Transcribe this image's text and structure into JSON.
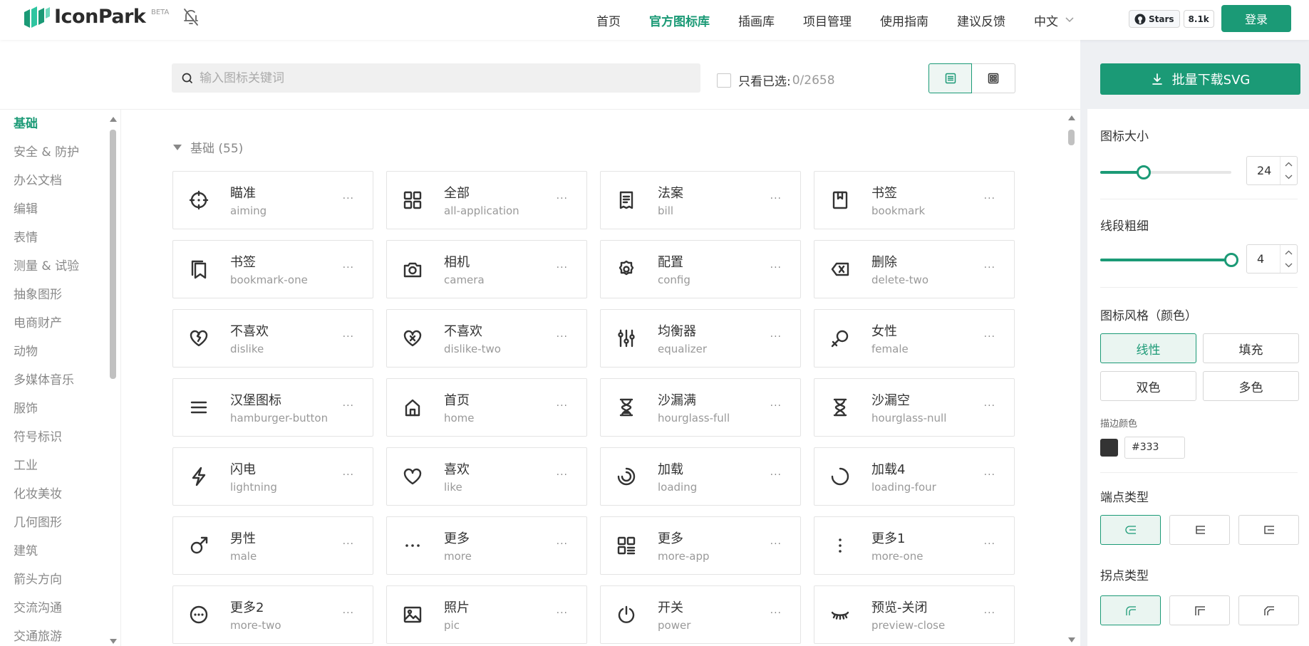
{
  "header": {
    "logo_text": "IconPark",
    "beta_label": "BETA",
    "nav": [
      {
        "label": "首页"
      },
      {
        "label": "官方图标库",
        "active": true
      },
      {
        "label": "插画库"
      },
      {
        "label": "项目管理"
      },
      {
        "label": "使用指南"
      },
      {
        "label": "建议反馈"
      }
    ],
    "language": "中文",
    "github": {
      "stars_label": "Stars",
      "count": "8.1k"
    },
    "login_label": "登录",
    "accent_color": "#1b9a76"
  },
  "toolbar": {
    "search_placeholder": "输入图标关键词",
    "only_selected_label": "只看已选:",
    "selected_count": "0/2658"
  },
  "sidebar": {
    "categories": [
      {
        "label": "基础",
        "active": true
      },
      {
        "label": "安全 & 防护"
      },
      {
        "label": "办公文档"
      },
      {
        "label": "编辑"
      },
      {
        "label": "表情"
      },
      {
        "label": "测量 & 试验"
      },
      {
        "label": "抽象图形"
      },
      {
        "label": "电商财产"
      },
      {
        "label": "动物"
      },
      {
        "label": "多媒体音乐"
      },
      {
        "label": "服饰"
      },
      {
        "label": "符号标识"
      },
      {
        "label": "工业"
      },
      {
        "label": "化妆美妆"
      },
      {
        "label": "几何图形"
      },
      {
        "label": "建筑"
      },
      {
        "label": "箭头方向"
      },
      {
        "label": "交流沟通"
      },
      {
        "label": "交通旅游"
      }
    ]
  },
  "main": {
    "section_title": "基础 (55)",
    "more_label": "···",
    "icons": [
      {
        "cn": "瞄准",
        "en": "aiming",
        "icon": "aiming-icon"
      },
      {
        "cn": "全部",
        "en": "all-application",
        "icon": "all-application-icon"
      },
      {
        "cn": "法案",
        "en": "bill",
        "icon": "bill-icon"
      },
      {
        "cn": "书签",
        "en": "bookmark",
        "icon": "bookmark-icon"
      },
      {
        "cn": "书签",
        "en": "bookmark-one",
        "icon": "bookmark-one-icon"
      },
      {
        "cn": "相机",
        "en": "camera",
        "icon": "camera-icon"
      },
      {
        "cn": "配置",
        "en": "config",
        "icon": "config-icon"
      },
      {
        "cn": "删除",
        "en": "delete-two",
        "icon": "delete-two-icon"
      },
      {
        "cn": "不喜欢",
        "en": "dislike",
        "icon": "dislike-icon"
      },
      {
        "cn": "不喜欢",
        "en": "dislike-two",
        "icon": "dislike-two-icon"
      },
      {
        "cn": "均衡器",
        "en": "equalizer",
        "icon": "equalizer-icon"
      },
      {
        "cn": "女性",
        "en": "female",
        "icon": "female-icon"
      },
      {
        "cn": "汉堡图标",
        "en": "hamburger-button",
        "icon": "hamburger-button-icon"
      },
      {
        "cn": "首页",
        "en": "home",
        "icon": "home-icon"
      },
      {
        "cn": "沙漏满",
        "en": "hourglass-full",
        "icon": "hourglass-full-icon"
      },
      {
        "cn": "沙漏空",
        "en": "hourglass-null",
        "icon": "hourglass-null-icon"
      },
      {
        "cn": "闪电",
        "en": "lightning",
        "icon": "lightning-icon"
      },
      {
        "cn": "喜欢",
        "en": "like",
        "icon": "like-icon"
      },
      {
        "cn": "加载",
        "en": "loading",
        "icon": "loading-icon"
      },
      {
        "cn": "加载4",
        "en": "loading-four",
        "icon": "loading-four-icon"
      },
      {
        "cn": "男性",
        "en": "male",
        "icon": "male-icon"
      },
      {
        "cn": "更多",
        "en": "more",
        "icon": "more-icon"
      },
      {
        "cn": "更多",
        "en": "more-app",
        "icon": "more-app-icon"
      },
      {
        "cn": "更多1",
        "en": "more-one",
        "icon": "more-one-icon"
      },
      {
        "cn": "更多2",
        "en": "more-two",
        "icon": "more-two-icon"
      },
      {
        "cn": "照片",
        "en": "pic",
        "icon": "pic-icon"
      },
      {
        "cn": "开关",
        "en": "power",
        "icon": "power-icon"
      },
      {
        "cn": "预览-关闭",
        "en": "preview-close",
        "icon": "preview-close-icon"
      }
    ]
  },
  "panel": {
    "download_label": "批量下载SVG",
    "size_label": "图标大小",
    "size_value": "24",
    "size_fraction": 0.33,
    "stroke_label": "线段粗细",
    "stroke_value": "4",
    "stroke_fraction": 1.0,
    "style_label": "图标风格（颜色）",
    "styles": [
      {
        "label": "线性",
        "active": true
      },
      {
        "label": "填充"
      },
      {
        "label": "双色"
      },
      {
        "label": "多色"
      }
    ],
    "stroke_color_label": "描边颜色",
    "stroke_color": "#333",
    "cap_label": "端点类型",
    "join_label": "拐点类型"
  }
}
